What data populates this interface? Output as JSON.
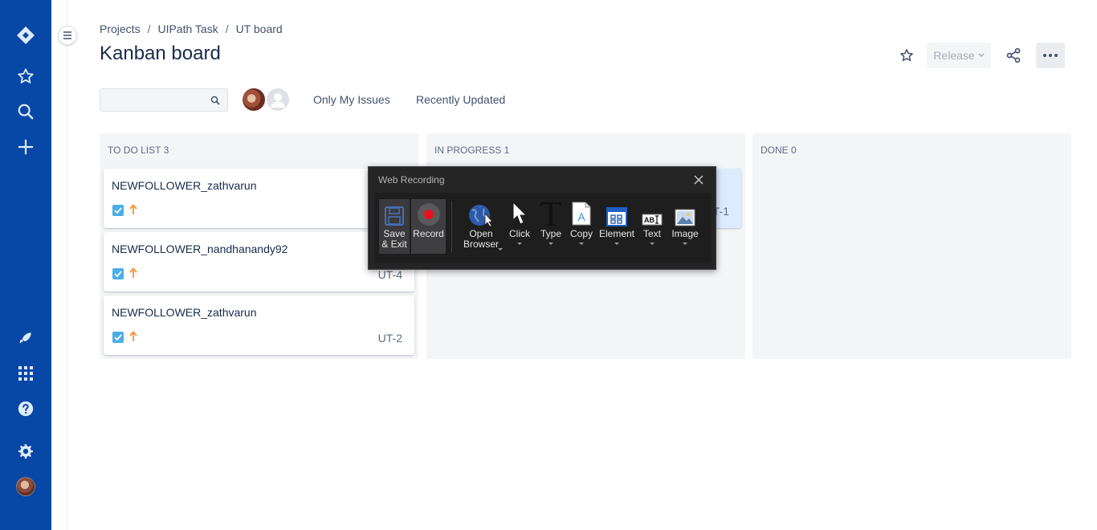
{
  "global_nav": {
    "icons": [
      "jira-logo-icon",
      "star-icon",
      "search-icon",
      "create-plus-icon",
      "rocket-icon",
      "app-switcher-icon",
      "help-icon",
      "settings-icon",
      "profile-avatar"
    ],
    "background": "#0747a6"
  },
  "breadcrumb": {
    "items": [
      "Projects",
      "UIPath Task",
      "UT board"
    ],
    "separator": "/"
  },
  "page": {
    "title": "Kanban board"
  },
  "header_actions": {
    "release_label": "Release"
  },
  "search": {
    "placeholder": ""
  },
  "filters": {
    "only_my_issues": "Only My Issues",
    "recently_updated": "Recently Updated"
  },
  "board": {
    "columns": [
      {
        "title": "TO DO LIST 3",
        "cards": [
          {
            "summary": "NEWFOLLOWER_zathvarun",
            "key": ""
          },
          {
            "summary": "NEWFOLLOWER_nandhanandy92",
            "key": "UT-4"
          },
          {
            "summary": "NEWFOLLOWER_zathvarun",
            "key": "UT-2"
          }
        ]
      },
      {
        "title": "IN PROGRESS 1",
        "cards": [
          {
            "summary": "",
            "key": "T-1"
          }
        ]
      },
      {
        "title": "DONE 0",
        "cards": []
      }
    ]
  },
  "recorder": {
    "title": "Web Recording",
    "tools": [
      {
        "label_line1": "Save",
        "label_line2": "& Exit",
        "icon": "save-disk-icon"
      },
      {
        "label_line1": "Record",
        "label_line2": "",
        "icon": "record-icon"
      },
      {
        "label_line1": "Open",
        "label_line2": "Browser",
        "icon": "globe-cursor-icon"
      },
      {
        "label_line1": "Click",
        "label_line2": "",
        "icon": "pointer-icon"
      },
      {
        "label_line1": "Type",
        "label_line2": "",
        "icon": "type-t-icon"
      },
      {
        "label_line1": "Copy",
        "label_line2": "",
        "icon": "copy-document-icon"
      },
      {
        "label_line1": "Element",
        "label_line2": "",
        "icon": "element-window-icon"
      },
      {
        "label_line1": "Text",
        "label_line2": "",
        "icon": "text-abi-icon"
      },
      {
        "label_line1": "Image",
        "label_line2": "",
        "icon": "image-icon"
      }
    ]
  },
  "colors": {
    "accent": "#0052cc",
    "priority_arrow": "#f79232",
    "story_checkbox": "#4bade8",
    "record_dot": "#e81123"
  }
}
